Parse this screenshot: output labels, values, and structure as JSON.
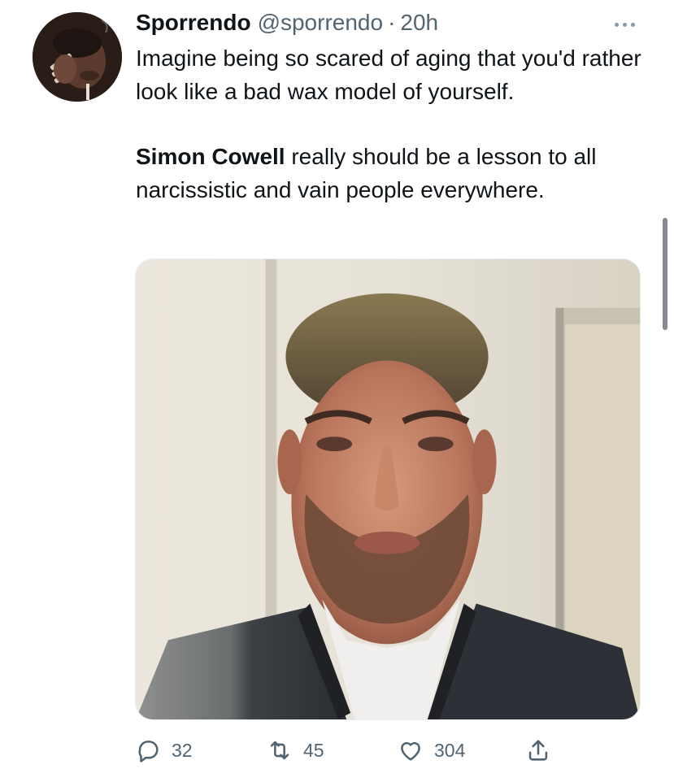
{
  "tweet": {
    "author_name": "Sporrendo",
    "author_handle": "@sporrendo",
    "separator": "·",
    "time": "20h",
    "text_line1": "Imagine being so scared of aging that you'd rather look like a bad wax model of yourself.",
    "mention": "Simon Cowell",
    "text_line2_rest": " really should be a lesson to all narcissistic and vain people everywhere."
  },
  "actions": {
    "replies": "32",
    "retweets": "45",
    "likes": "304"
  },
  "icons": {
    "more": "more-horizontal-icon",
    "reply": "reply-icon",
    "retweet": "retweet-icon",
    "like": "heart-icon",
    "share": "share-icon"
  },
  "colors": {
    "text": "#0f1419",
    "muted": "#536471",
    "icon": "#536471"
  }
}
